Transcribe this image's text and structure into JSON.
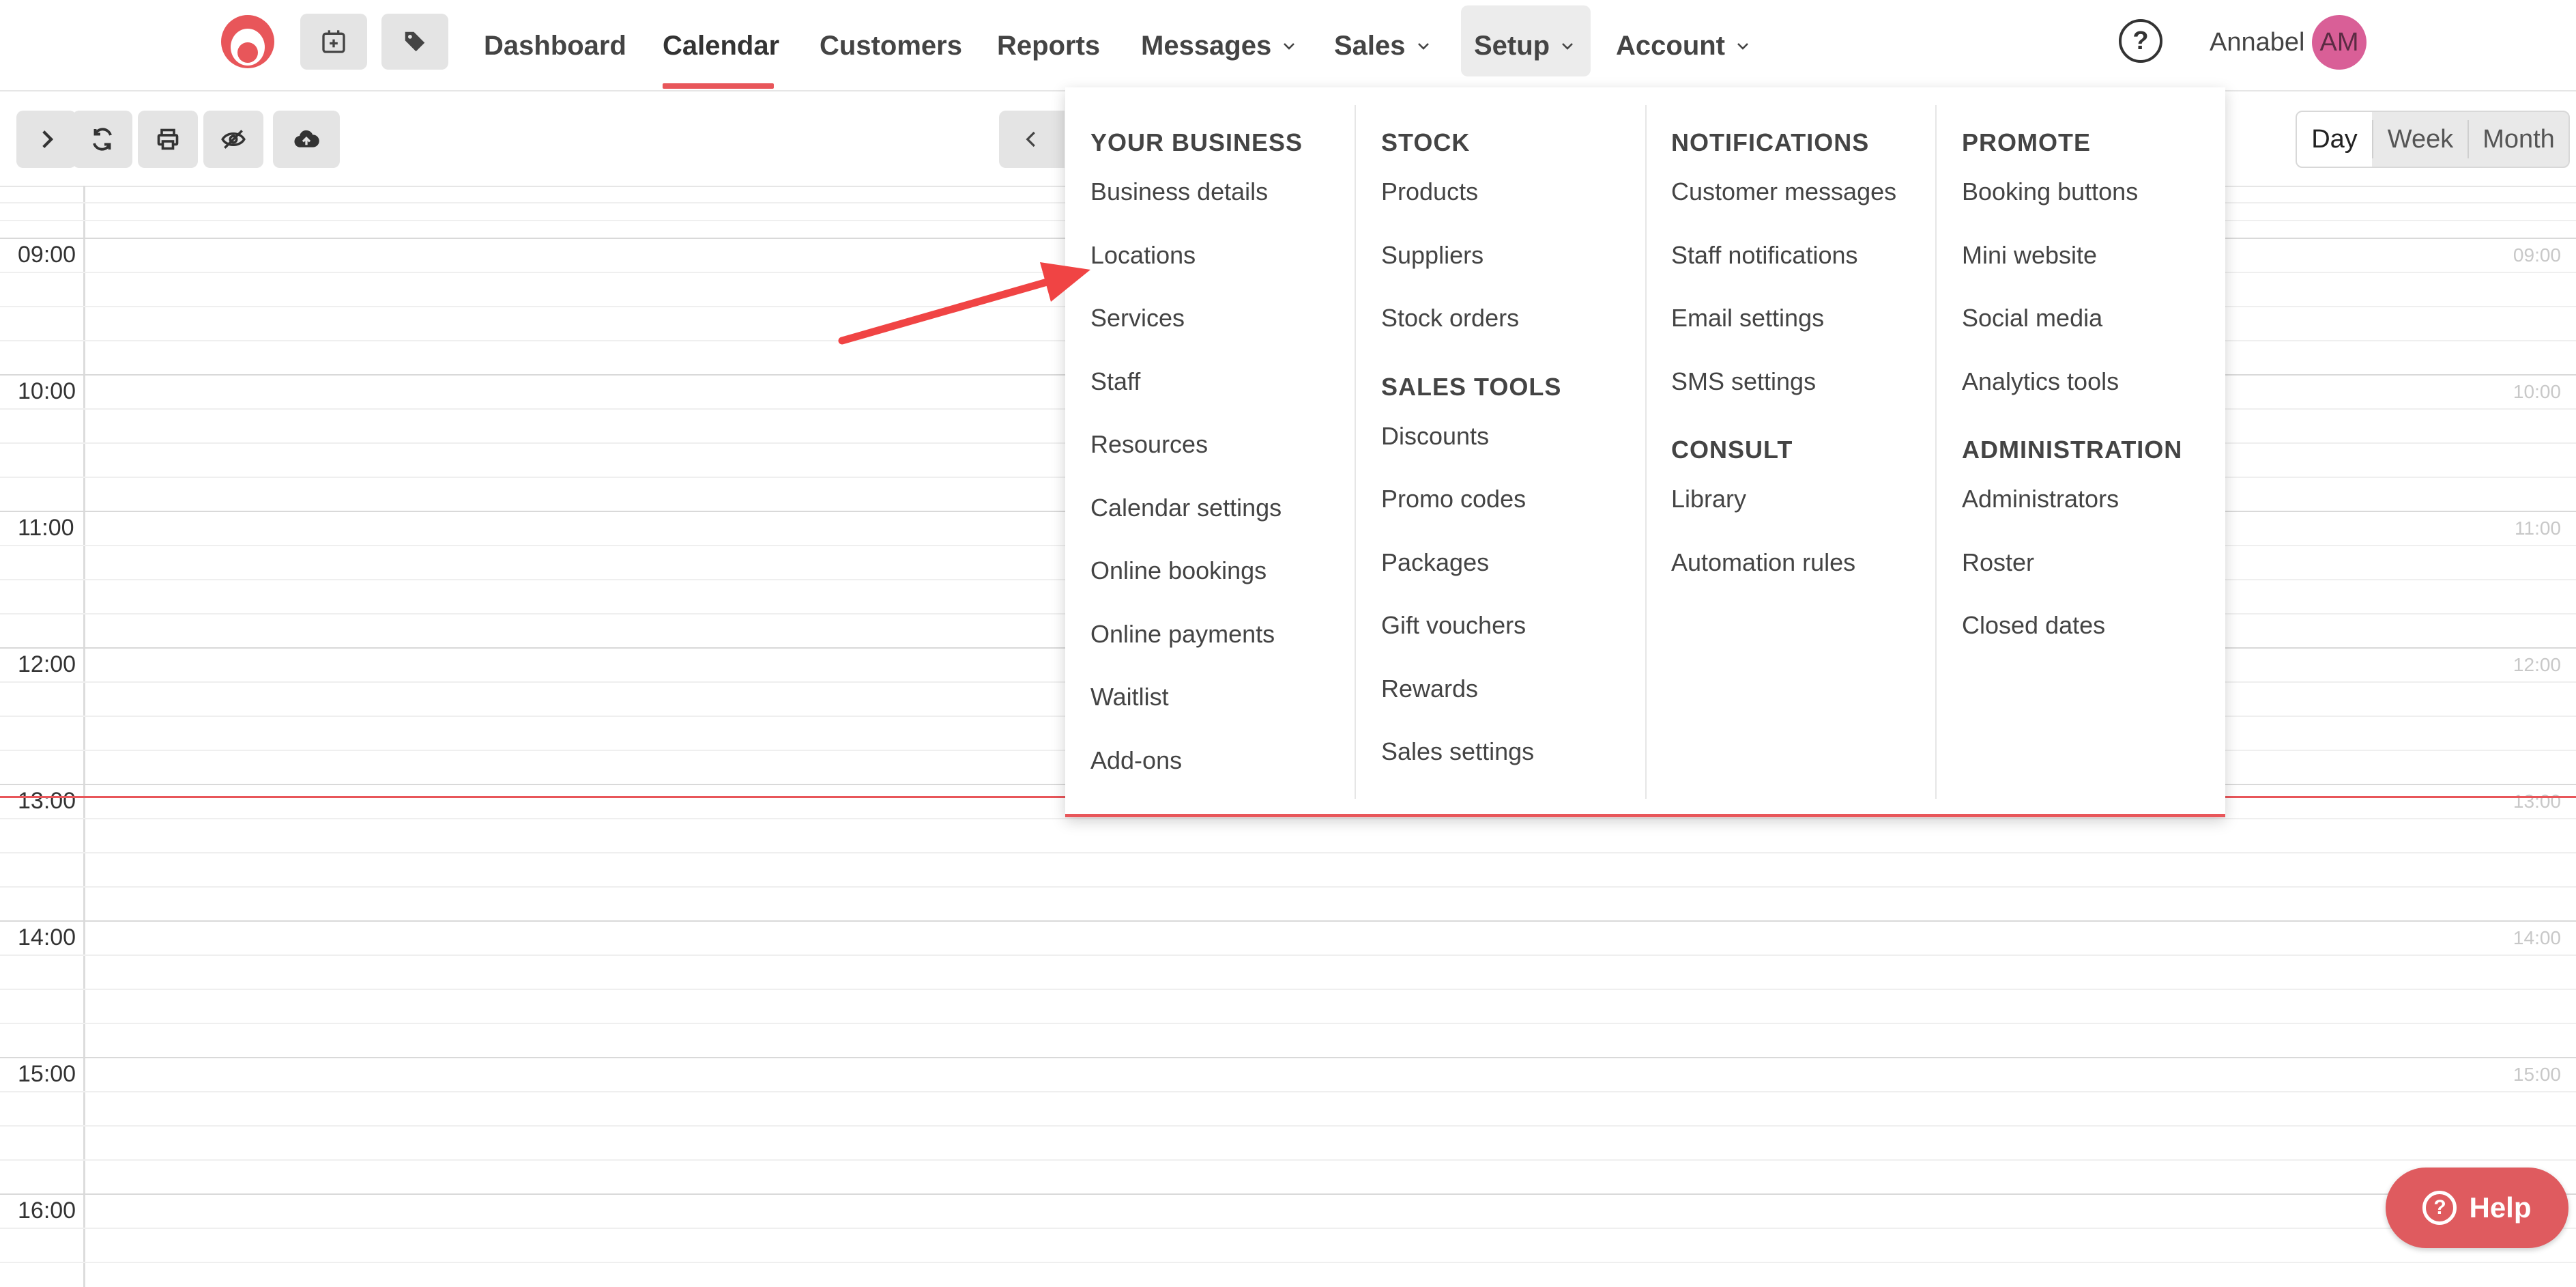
{
  "nav": {
    "items": [
      "Dashboard",
      "Calendar",
      "Customers",
      "Reports",
      "Messages",
      "Sales",
      "Setup",
      "Account"
    ],
    "active": "Calendar",
    "open": "Setup",
    "help_glyph": "?",
    "user_name": "Annabel",
    "avatar_initials": "AM",
    "accent_color": "#e8565a"
  },
  "toolbar": {
    "icons": [
      "chevron-right-icon",
      "refresh-icon",
      "print-icon",
      "hide-icon",
      "cloud-upload-icon"
    ],
    "prev_icon": "chevron-left-icon",
    "views": [
      "Day",
      "Week",
      "Month"
    ],
    "active_view": "Day"
  },
  "calendar": {
    "hours": [
      "09:00",
      "10:00",
      "11:00",
      "12:00",
      "13:00",
      "14:00",
      "15:00",
      "16:00"
    ]
  },
  "setup_menu": {
    "columns": [
      {
        "sections": [
          {
            "heading": "YOUR BUSINESS",
            "items": [
              "Business details",
              "Locations",
              "Services",
              "Staff",
              "Resources",
              "Calendar settings",
              "Online bookings",
              "Online payments",
              "Waitlist",
              "Add-ons"
            ]
          }
        ]
      },
      {
        "sections": [
          {
            "heading": "STOCK",
            "items": [
              "Products",
              "Suppliers",
              "Stock orders"
            ]
          },
          {
            "heading": "SALES TOOLS",
            "items": [
              "Discounts",
              "Promo codes",
              "Packages",
              "Gift vouchers",
              "Rewards",
              "Sales settings"
            ]
          }
        ]
      },
      {
        "sections": [
          {
            "heading": "NOTIFICATIONS",
            "items": [
              "Customer messages",
              "Staff notifications",
              "Email settings",
              "SMS settings"
            ]
          },
          {
            "heading": "CONSULT",
            "items": [
              "Library",
              "Automation rules"
            ]
          }
        ]
      },
      {
        "sections": [
          {
            "heading": "PROMOTE",
            "items": [
              "Booking buttons",
              "Mini website",
              "Social media",
              "Analytics tools"
            ]
          },
          {
            "heading": "ADMINISTRATION",
            "items": [
              "Administrators",
              "Roster",
              "Closed dates"
            ]
          }
        ]
      }
    ]
  },
  "annotation": {
    "arrow_color": "#f04444",
    "points_to": "Locations"
  },
  "help_button": {
    "label": "Help",
    "glyph": "?"
  }
}
